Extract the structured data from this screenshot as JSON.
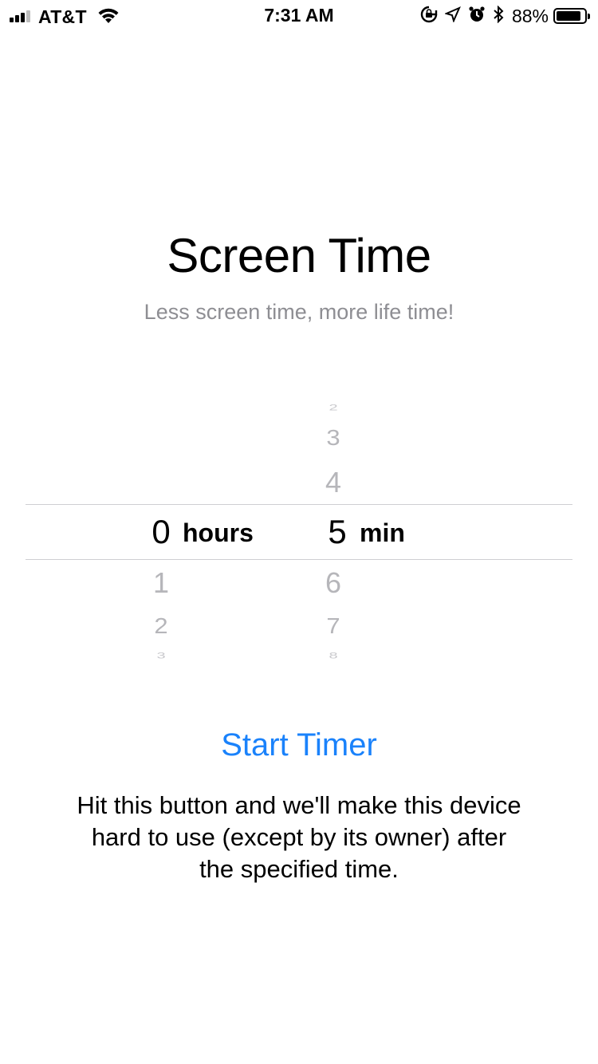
{
  "status_bar": {
    "carrier": "AT&T",
    "time": "7:31 AM",
    "battery_percent": "88%",
    "battery_level": 0.88,
    "icons": [
      "signal-icon",
      "wifi-icon",
      "orientation-lock-icon",
      "location-icon",
      "alarm-icon",
      "bluetooth-icon",
      "battery-icon"
    ]
  },
  "header": {
    "title": "Screen Time",
    "subtitle": "Less screen time, more life time!"
  },
  "picker": {
    "hours": {
      "selected": "0",
      "unit": "hours",
      "below": [
        "1",
        "2",
        "3"
      ]
    },
    "minutes": {
      "selected": "5",
      "unit": "min",
      "above": [
        "2",
        "3",
        "4"
      ],
      "below": [
        "6",
        "7",
        "8"
      ]
    }
  },
  "action": {
    "start_label": "Start Timer",
    "accent_color": "#1a82fb",
    "description": "Hit this button and we'll make this device hard to use (except by its owner) after the specified time."
  }
}
